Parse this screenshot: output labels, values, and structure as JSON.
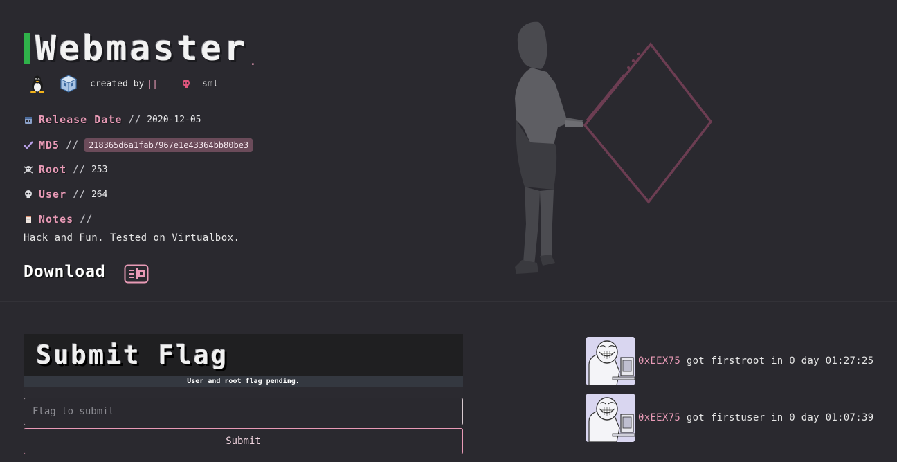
{
  "machine": {
    "name": "Webmaster",
    "title_dot": ".",
    "created_by_label": "created by",
    "author_separator": "||",
    "author": "sml",
    "os_icon": "linux-icon",
    "platform_icon": "virtualbox-icon"
  },
  "fields": {
    "release_date": {
      "label": "Release Date",
      "sep": "//",
      "value": "2020-12-05"
    },
    "md5": {
      "label": "MD5",
      "sep": "//",
      "value": "218365d6a1fab7967e1e43364bb80be3"
    },
    "root": {
      "label": "Root",
      "sep": "//",
      "value": "253"
    },
    "user": {
      "label": "User",
      "sep": "//",
      "value": "264"
    },
    "notes": {
      "label": "Notes",
      "sep": "//",
      "value": "Hack and Fun. Tested on Virtualbox."
    }
  },
  "download": {
    "label": "Download"
  },
  "flag": {
    "title": "Submit Flag",
    "status": "User and root flag pending.",
    "placeholder": "Flag to submit",
    "submit_label": "Submit"
  },
  "feed": [
    {
      "user": "0xEEX75",
      "action": "got firstroot in 0 day 01:27:25"
    },
    {
      "user": "0xEEX75",
      "action": "got firstuser in 0 day 01:07:39"
    }
  ],
  "colors": {
    "background": "#2a292f",
    "accent_pink": "#e89ab6",
    "title_bar_green": "#2fb24a",
    "md5_badge": "#6b4b5a"
  }
}
